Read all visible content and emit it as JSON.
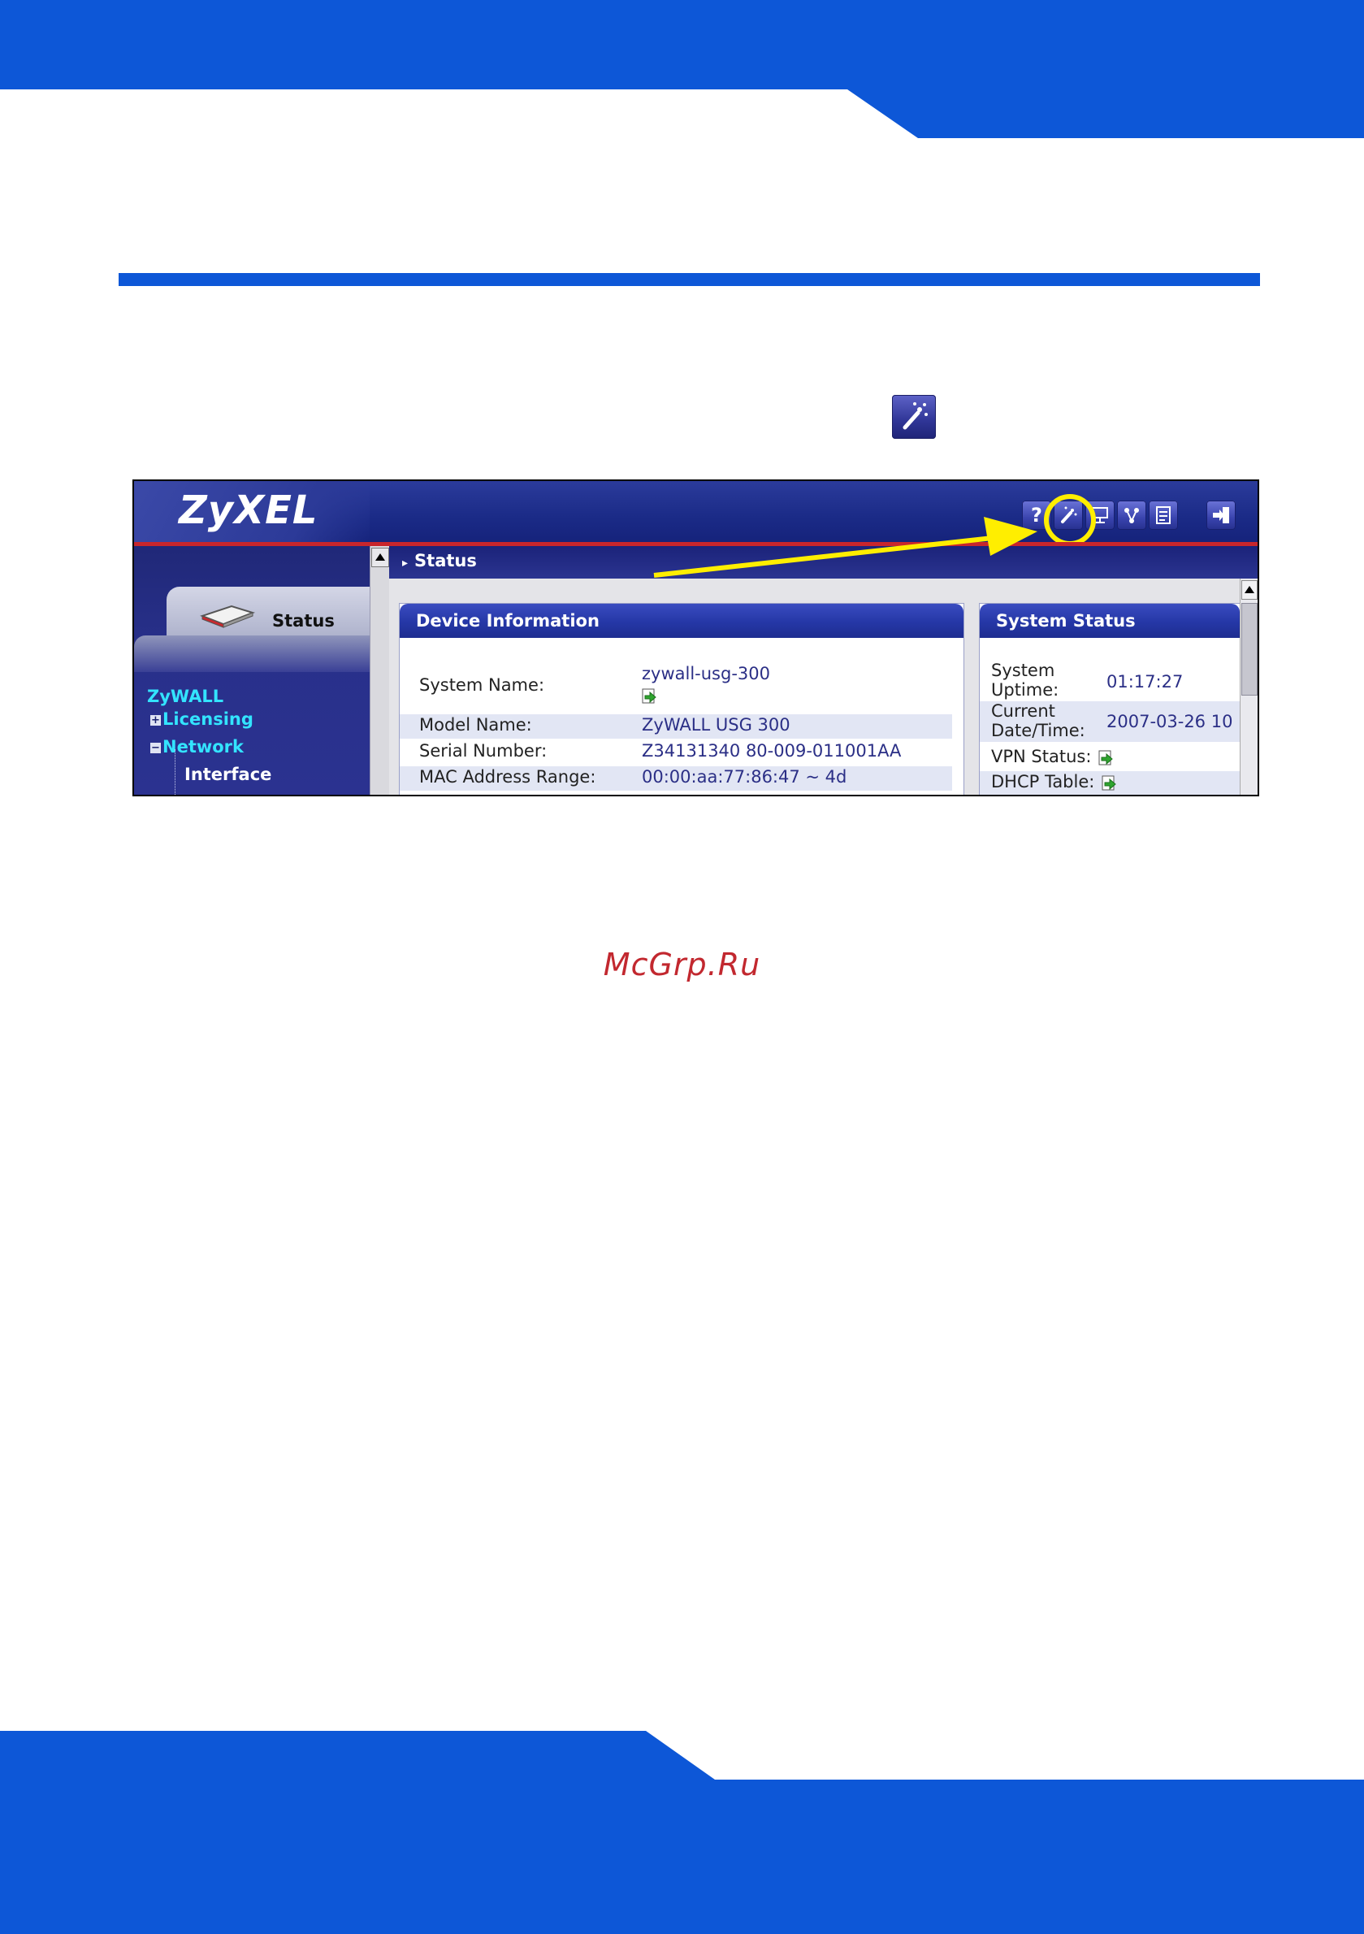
{
  "colors": {
    "brand_blue": "#0d57d7",
    "highlight_yellow": "#ffee00",
    "watermark_red": "#c2282f"
  },
  "inline_icon": {
    "name": "wizard-icon"
  },
  "screenshot": {
    "logo": "ZyXEL",
    "toolbar_icons": [
      "help-icon",
      "wizard-icon",
      "console-icon",
      "network-map-icon",
      "log-icon",
      "logout-icon"
    ],
    "highlighted_icon": "wizard-icon",
    "nav": {
      "status_tab": "Status",
      "items": [
        {
          "label": "ZyWALL"
        },
        {
          "label": "Licensing",
          "expander": "+"
        },
        {
          "label": "Network",
          "expander": "−"
        },
        {
          "label": "Interface"
        }
      ]
    },
    "breadcrumb": "Status",
    "device_information": {
      "title": "Device Information",
      "rows": [
        {
          "label": "System Name:",
          "value": "zywall-usg-300"
        },
        {
          "label": "Model Name:",
          "value": "ZyWALL USG 300"
        },
        {
          "label": "Serial Number:",
          "value": "Z34131340 80-009-011001AA"
        },
        {
          "label": "MAC Address Range:",
          "value": "00:00:aa:77:86:47 ~ 4d"
        }
      ]
    },
    "system_status": {
      "title": "System Status",
      "rows": [
        {
          "label_line1": "System",
          "label_line2": "Uptime:",
          "value": "01:17:27"
        },
        {
          "label_line1": "Current",
          "label_line2": "Date/Time:",
          "value": "2007-03-26 10"
        },
        {
          "label": "VPN Status:"
        },
        {
          "label": "DHCP Table:"
        }
      ]
    }
  },
  "watermark": "McGrp.Ru"
}
